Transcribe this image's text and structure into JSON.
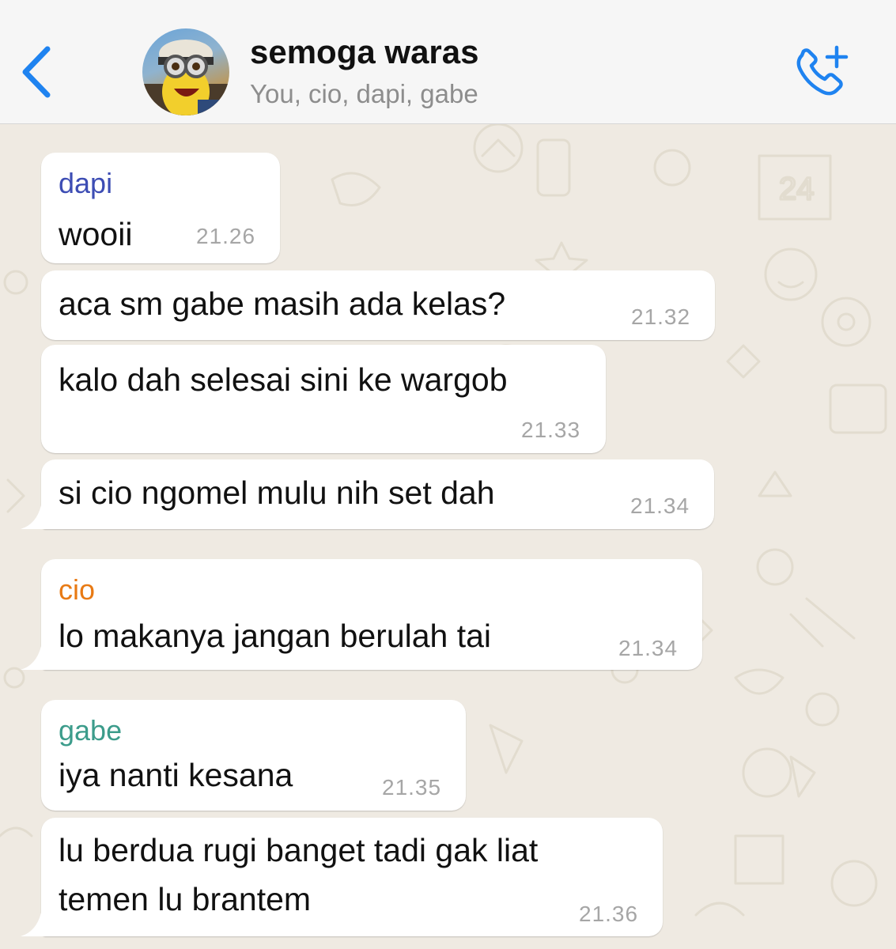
{
  "header": {
    "title": "semoga waras",
    "subtitle": "You, cio, dapi, gabe",
    "accent": "#1f83f0"
  },
  "messages": [
    {
      "sender": "dapi",
      "sender_color": "#3d4db4",
      "text": "wooii",
      "time": "21.26"
    },
    {
      "sender": "",
      "text": "aca sm gabe masih ada kelas?",
      "time": "21.32"
    },
    {
      "sender": "",
      "text": "kalo dah selesai sini ke wargob",
      "time": "21.33"
    },
    {
      "sender": "",
      "text": "si cio ngomel mulu nih set dah",
      "time": "21.34"
    },
    {
      "sender": "cio",
      "sender_color": "#e87a14",
      "text": "lo makanya jangan berulah tai",
      "time": "21.34"
    },
    {
      "sender": "gabe",
      "sender_color": "#3c9c8b",
      "text": "iya nanti kesana",
      "time": "21.35"
    },
    {
      "sender": "",
      "text": "lu berdua rugi banget tadi gak liat\ntemen lu brantem",
      "time": "21.36"
    }
  ]
}
